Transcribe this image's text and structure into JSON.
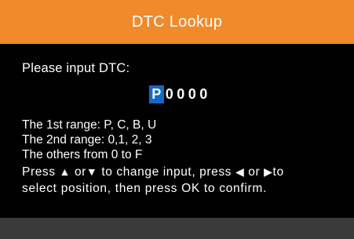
{
  "header": {
    "title": "DTC Lookup"
  },
  "colors": {
    "title_bar": "#f08a2a",
    "background": "#000000",
    "selection": "#1469c4",
    "bottom_bar": "#3a3a3a",
    "text": "#ffffff"
  },
  "main": {
    "prompt": "Please input DTC:",
    "code": {
      "chars": [
        "P",
        "0",
        "0",
        "0",
        "0"
      ],
      "selected_index": 0
    },
    "ranges": [
      "The 1st range: P, C, B, U",
      "The 2nd range: 0,1, 2, 3",
      "The others from  0  to  F"
    ],
    "help": {
      "press": "Press",
      "up_arrow": "▲",
      "or1": "or",
      "down_arrow": "▼",
      "to_change": "to change input, press",
      "left_arrow": "◀",
      "or2": "or",
      "right_arrow": "▶",
      "to": "to",
      "line2": "select position, then press OK to confirm."
    }
  }
}
